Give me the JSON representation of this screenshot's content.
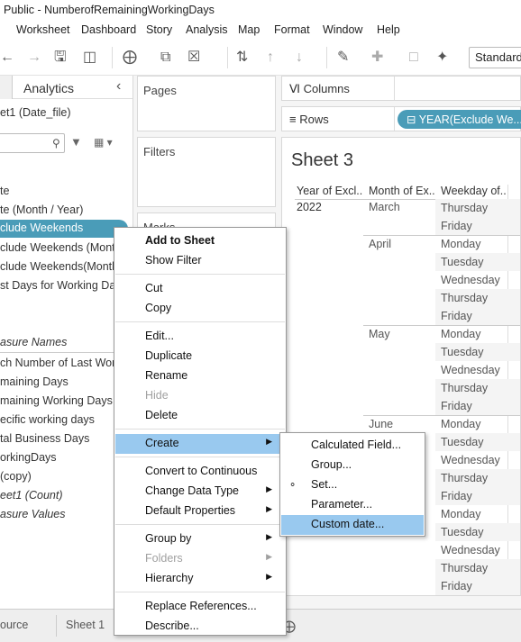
{
  "window": {
    "title": "Public - NumberofRemainingWorkingDays"
  },
  "menu": [
    "Worksheet",
    "Dashboard",
    "Story",
    "Analysis",
    "Map",
    "Format",
    "Window",
    "Help"
  ],
  "toolbar": {
    "standard_label": "Standard"
  },
  "datapane": {
    "analytics_tab": "Analytics",
    "datasource": "et1 (Date_file)",
    "fields": [
      "te",
      "te (Month / Year)",
      "clude Weekends",
      "clude Weekends (Mont...",
      "clude Weekends(Month...",
      "st Days for Working Day..."
    ],
    "measure_names": "asure Names",
    "measures": [
      "ch Number of Last Wor...",
      "maining Days",
      "maining Working Days",
      "ecific working days",
      "tal Business Days",
      "orkingDays",
      " (copy)",
      "eet1 (Count)",
      "asure Values"
    ]
  },
  "cards": {
    "pages": "Pages",
    "filters": "Filters",
    "marks": "Marks"
  },
  "shelves": {
    "columns": "Columns",
    "rows": "Rows",
    "rows_pill": "⊟ YEAR(Exclude We..."
  },
  "view": {
    "sheet_title": "Sheet 3",
    "headers": [
      "Year of Excl..",
      "Month of Ex..",
      "Weekday of.."
    ],
    "year": "2022",
    "months": [
      "March",
      "April",
      "May",
      "June"
    ],
    "weekdays": [
      "Thursday",
      "Friday",
      "Monday",
      "Tuesday",
      "Wednesday",
      "Thursday",
      "Friday",
      "Monday",
      "Tuesday",
      "Wednesday",
      "Thursday",
      "Friday",
      "Monday",
      "Tuesday",
      "Wednesday",
      "Thursday",
      "Friday",
      "Monday",
      "Tuesday",
      "Wednesday",
      "Thursday",
      "Friday"
    ]
  },
  "bottom": {
    "datasource_tab": "ource",
    "sheet1_tab": "Sheet 1"
  },
  "context_menu": {
    "add_to_sheet": "Add to Sheet",
    "show_filter": "Show Filter",
    "cut": "Cut",
    "copy": "Copy",
    "edit": "Edit...",
    "duplicate": "Duplicate",
    "rename": "Rename",
    "hide": "Hide",
    "delete": "Delete",
    "create": "Create",
    "convert": "Convert to Continuous",
    "change_type": "Change Data Type",
    "default_props": "Default Properties",
    "group_by": "Group by",
    "folders": "Folders",
    "hierarchy": "Hierarchy",
    "replace_refs": "Replace References...",
    "describe": "Describe..."
  },
  "create_submenu": {
    "calculated_field": "Calculated Field...",
    "group": "Group...",
    "set": "Set...",
    "parameter": "Parameter...",
    "custom_date": "Custom date..."
  },
  "colors": {
    "accent": "#4a9cb8",
    "menu_highlight": "#99c9ef"
  }
}
